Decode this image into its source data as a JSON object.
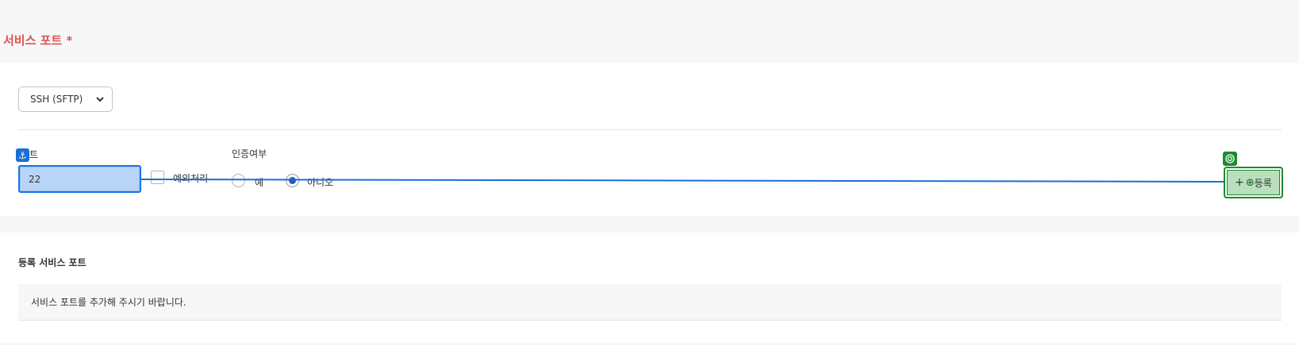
{
  "section": {
    "title": "서비스 포트 *"
  },
  "protocol_select": {
    "selected": "SSH (SFTP)"
  },
  "port_field": {
    "label": "포트",
    "value": "22"
  },
  "exception": {
    "label": "예외처리",
    "checked": false
  },
  "auth": {
    "label": "인증여부",
    "options": [
      {
        "label": "예",
        "selected": false
      },
      {
        "label": "아니오",
        "selected": true
      }
    ]
  },
  "add_button": {
    "label": "등록"
  },
  "registered": {
    "title": "등록 서비스 포트",
    "empty_message": "서비스 포트를 추가해 주시기 바랍니다."
  },
  "colors": {
    "title_red": "#e05252",
    "anchor_blue": "#1a6fd8",
    "target_green": "#1e8a2e",
    "radio_blue": "#2259c4"
  },
  "icons": {
    "anchor": "anchor-icon",
    "target": "target-icon",
    "plus": "plus-icon",
    "crosshair": "crosshair-icon",
    "chevron": "chevron-down-icon"
  }
}
